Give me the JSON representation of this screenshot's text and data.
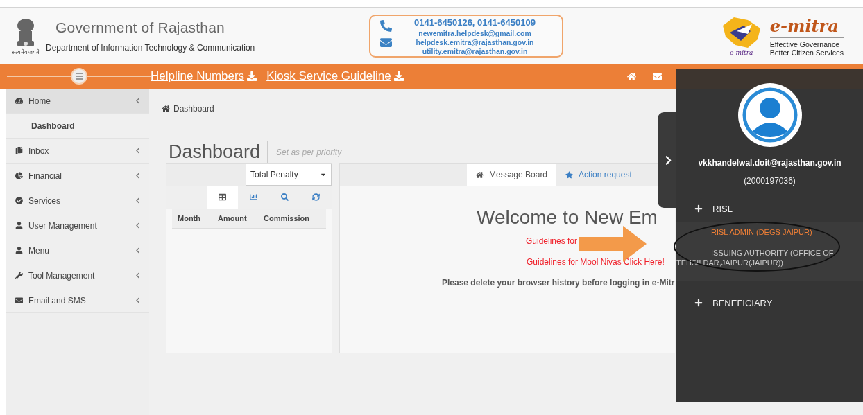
{
  "header": {
    "title": "Government of Rajasthan",
    "subtitle": "Department of Information Technology & Communication",
    "emblem_caption": "सत्यमेव जयते",
    "phones": "0141-6450126, 0141-6450109",
    "emails": [
      "newemitra.helpdesk@gmail.com",
      "helpdesk.emitra@rajasthan.gov.in",
      "utility.emitra@rajasthan.gov.in"
    ],
    "brand": {
      "name": "e-mitra",
      "taglines": [
        "Effective Governance",
        "Better Citizen Services"
      ],
      "logo_caption": "e-mitra"
    }
  },
  "nav": {
    "links": [
      "Helpline Numbers",
      "Kiosk Service Guideline"
    ]
  },
  "sidebar": {
    "items": [
      {
        "label": "Home",
        "expanded": true,
        "children": [
          {
            "label": "Dashboard"
          }
        ]
      },
      {
        "label": "Inbox",
        "expanded": false
      },
      {
        "label": "Financial",
        "expanded": false
      },
      {
        "label": "Services",
        "expanded": false
      },
      {
        "label": "User Management",
        "expanded": false
      },
      {
        "label": "Menu",
        "expanded": false
      },
      {
        "label": "Tool Management",
        "expanded": false
      },
      {
        "label": "Email and SMS",
        "expanded": false
      }
    ]
  },
  "breadcrumb": "Dashboard",
  "page": {
    "title": "Dashboard",
    "subtitle": "Set as per priority"
  },
  "summary_widget": {
    "select": "Total Penalty",
    "tabs": [
      {
        "selected": true
      },
      {
        "selected": false
      },
      {
        "selected": false
      },
      {
        "selected": false
      }
    ],
    "columns": [
      "Month",
      "Amount",
      "Commission"
    ]
  },
  "message_board": {
    "tabs": [
      {
        "label": "Message Board",
        "selected": true
      },
      {
        "label": "Action request",
        "selected": false
      }
    ],
    "welcome": "Welcome to New Em",
    "links": [
      "Guidelines for",
      "Guidelines for Mool Nivas Click Here!"
    ],
    "notice": "Please delete your browser history before logging in e-Mitr"
  },
  "user_panel": {
    "email": "vkkhandelwal.doit@rajasthan.gov.in",
    "user_id": "(2000197036)",
    "groups": [
      {
        "label": "RISL",
        "children": [
          {
            "label": "RISL ADMIN (DEGS JAIPUR)",
            "selected": true,
            "circled": false
          },
          {
            "label": "ISSUING AUTHORITY (OFFICE OF TEHSILDAR,JAIPUR(JAIPUR))",
            "selected": false,
            "circled": true
          }
        ]
      },
      {
        "label": "BENEFICIARY"
      }
    ]
  }
}
